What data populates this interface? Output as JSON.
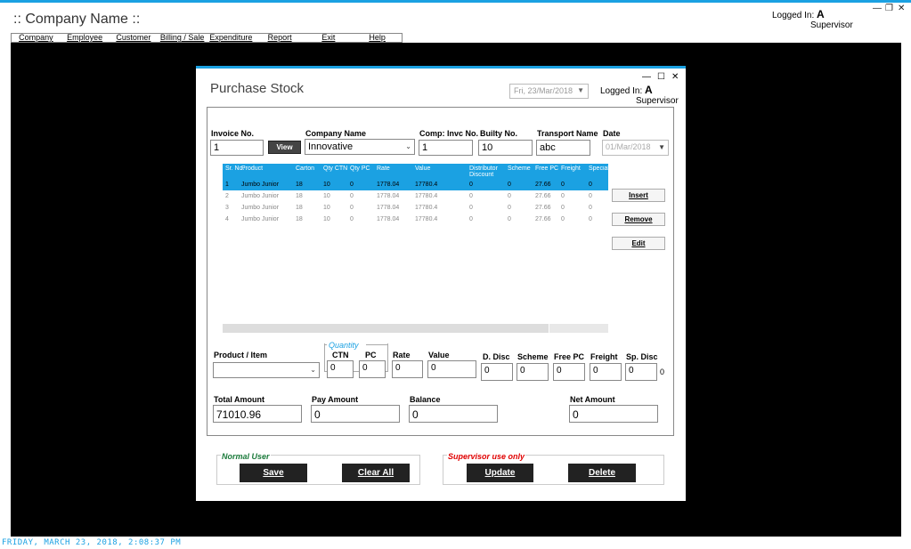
{
  "app": {
    "title": ":: Company Name ::",
    "logged_label": "Logged In:",
    "user": "A",
    "role": "Supervisor",
    "minimize": "—",
    "restore": "❐",
    "close": "✕"
  },
  "menu": [
    "Company",
    "Employee",
    "Customer",
    "Billing / Sale",
    "Expenditure",
    "Report",
    "Exit",
    "Help"
  ],
  "status": {
    "datetime": "FRIDAY, MARCH 23, 2018,  2:08:37 PM"
  },
  "dialog": {
    "title": "Purchase Stock",
    "current_date": "Fri, 23/Mar/2018",
    "logged_label": "Logged In:",
    "user": "A",
    "role": "Supervisor",
    "minimize": "—",
    "maximize": "☐",
    "close": "✕"
  },
  "header_fields": {
    "invoice_label": "Invoice No.",
    "invoice_value": "1",
    "view_label": "View",
    "company_label": "Company Name",
    "company_value": "Innovative",
    "comp_invc_label": "Comp: Invc No.",
    "comp_invc_value": "1",
    "builty_label": "Builty No.",
    "builty_value": "10",
    "transport_label": "Transport Name",
    "transport_value": "abc",
    "date_label": "Date",
    "date_value": "01/Mar/2018"
  },
  "grid": {
    "columns": [
      "Sr. No.",
      "Product",
      "Carton",
      "Qty CTN",
      "Qty PC",
      "Rate",
      "Value",
      "Distributor Discount",
      "Scheme",
      "Free PC",
      "Freight",
      "Special Discou"
    ],
    "rows": [
      [
        "1",
        "Jumbo Junior",
        "18",
        "10",
        "0",
        "1778.04",
        "17780.4",
        "0",
        "0",
        "27.66",
        "0",
        "0"
      ],
      [
        "2",
        "Jumbo Junior",
        "18",
        "10",
        "0",
        "1778.04",
        "17780.4",
        "0",
        "0",
        "27.66",
        "0",
        "0"
      ],
      [
        "3",
        "Jumbo Junior",
        "18",
        "10",
        "0",
        "1778.04",
        "17780.4",
        "0",
        "0",
        "27.66",
        "0",
        "0"
      ],
      [
        "4",
        "Jumbo Junior",
        "18",
        "10",
        "0",
        "1778.04",
        "17780.4",
        "0",
        "0",
        "27.66",
        "0",
        "0"
      ]
    ],
    "selected_row": 0
  },
  "side_buttons": {
    "insert": "Insert",
    "remove": "Remove",
    "edit": "Edit"
  },
  "item_fields": {
    "product_label": "Product / Item",
    "product_value": "",
    "quantity_label": "Quantity",
    "ctn_label": "CTN",
    "ctn_value": "0",
    "pc_label": "PC",
    "pc_value": "0",
    "rate_label": "Rate",
    "rate_value": "0",
    "value_label": "Value",
    "value_value": "0",
    "d_disc_label": "D. Disc",
    "d_disc_value": "0",
    "scheme_label": "Scheme",
    "scheme_value": "0",
    "free_pc_label": "Free PC",
    "free_pc_value": "0",
    "freight_label": "Freight",
    "freight_value": "0",
    "sp_disc_label": "Sp. Disc",
    "sp_disc_value": "0",
    "sp_disc_extra": "0"
  },
  "totals": {
    "total_label": "Total Amount",
    "total_value": "71010.96",
    "pay_label": "Pay Amount",
    "pay_value": "0",
    "balance_label": "Balance",
    "balance_value": "0",
    "net_label": "Net Amount",
    "net_value": "0"
  },
  "actions": {
    "normal_title": "Normal User",
    "save": "Save",
    "clear_all": "Clear All",
    "supervisor_title": "Supervisor use only",
    "update": "Update",
    "delete": "Delete"
  },
  "colors": {
    "accent": "#1ba1e2",
    "normal_title": "#1a7a3a",
    "supervisor_title": "#e00000"
  }
}
